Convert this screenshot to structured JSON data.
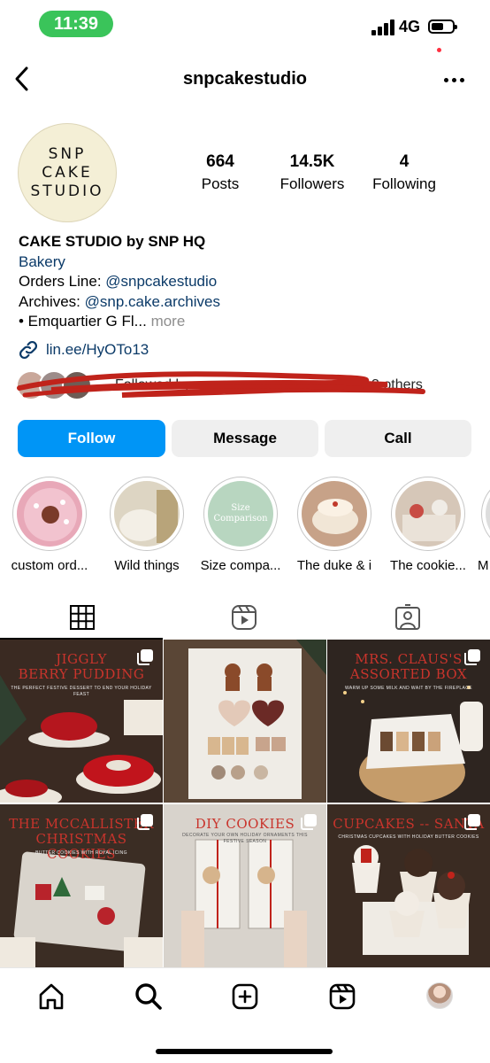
{
  "status_bar": {
    "time": "11:39",
    "network": "4G",
    "battery_level": 0.6
  },
  "header": {
    "username": "snpcakestudio",
    "back_icon": "chevron-left-icon",
    "more_icon": "more-horizontal-icon"
  },
  "profile": {
    "avatar_lines": [
      "SNP",
      "CAKE",
      "STUDIO"
    ],
    "stats": [
      {
        "value": "664",
        "label": "Posts"
      },
      {
        "value": "14.5K",
        "label": "Followers"
      },
      {
        "value": "4",
        "label": "Following"
      }
    ]
  },
  "bio": {
    "name": "CAKE STUDIO by SNP HQ",
    "category": "Bakery",
    "orders_label": "Orders Line: ",
    "orders_handle": "@snpcakestudio",
    "archives_label": "Archives: ",
    "archives_handle": "@snp.cake.archives",
    "location_line": "• Emquartier G Fl...",
    "more": "more",
    "link": "lin.ee/HyOTo13",
    "followed_by": "Followed by m_________________ and 3 others"
  },
  "buttons": {
    "follow": "Follow",
    "message": "Message",
    "call": "Call"
  },
  "highlights": [
    {
      "label": "custom ord...",
      "color": "#e8a8b8"
    },
    {
      "label": "Wild things",
      "color": "#ddd5c3"
    },
    {
      "label": "Size compa...",
      "color": "#b8d6c0",
      "inner_text": "Size Comparison"
    },
    {
      "label": "The duke & i",
      "color": "#c7a288"
    },
    {
      "label": "The cookie...",
      "color": "#d6c7b8"
    },
    {
      "label": "M",
      "color": "#ddd"
    }
  ],
  "tabs": [
    "grid-icon",
    "reels-icon",
    "tagged-icon"
  ],
  "posts": [
    {
      "title": "JIGGLY\nBERRY PUDDING",
      "subtitle": "THE PERFECT FESTIVE DESSERT TO END YOUR HOLIDAY FEAST",
      "bg": "#3a2a22"
    },
    {
      "title": "",
      "subtitle": "",
      "bg": "#5a4636"
    },
    {
      "title": "MRS. CLAUS'S\nASSORTED BOX",
      "subtitle": "WARM UP SOME MILK AND WAIT BY THE FIREPLACE",
      "bg": "#2e2520"
    },
    {
      "title": "THE MCCALLISTER\nCHRISTMAS COOKIES",
      "subtitle": "BUTTER COOKIES WITH ROYAL ICING",
      "bg": "#3b2d24"
    },
    {
      "title": "DIY COOKIES",
      "subtitle": "DECORATE YOUR OWN HOLIDAY ORNAMENTS THIS FESTIVE SEASON",
      "bg": "#d8d3cc"
    },
    {
      "title": "CUPCAKES -- SANTA",
      "subtitle": "CHRISTMAS CUPCAKES WITH HOLIDAY BUTTER COOKIES",
      "bg": "#3a2b22"
    }
  ],
  "bottom_nav": [
    "home-icon",
    "search-icon",
    "create-icon",
    "reels-icon",
    "profile-avatar"
  ]
}
